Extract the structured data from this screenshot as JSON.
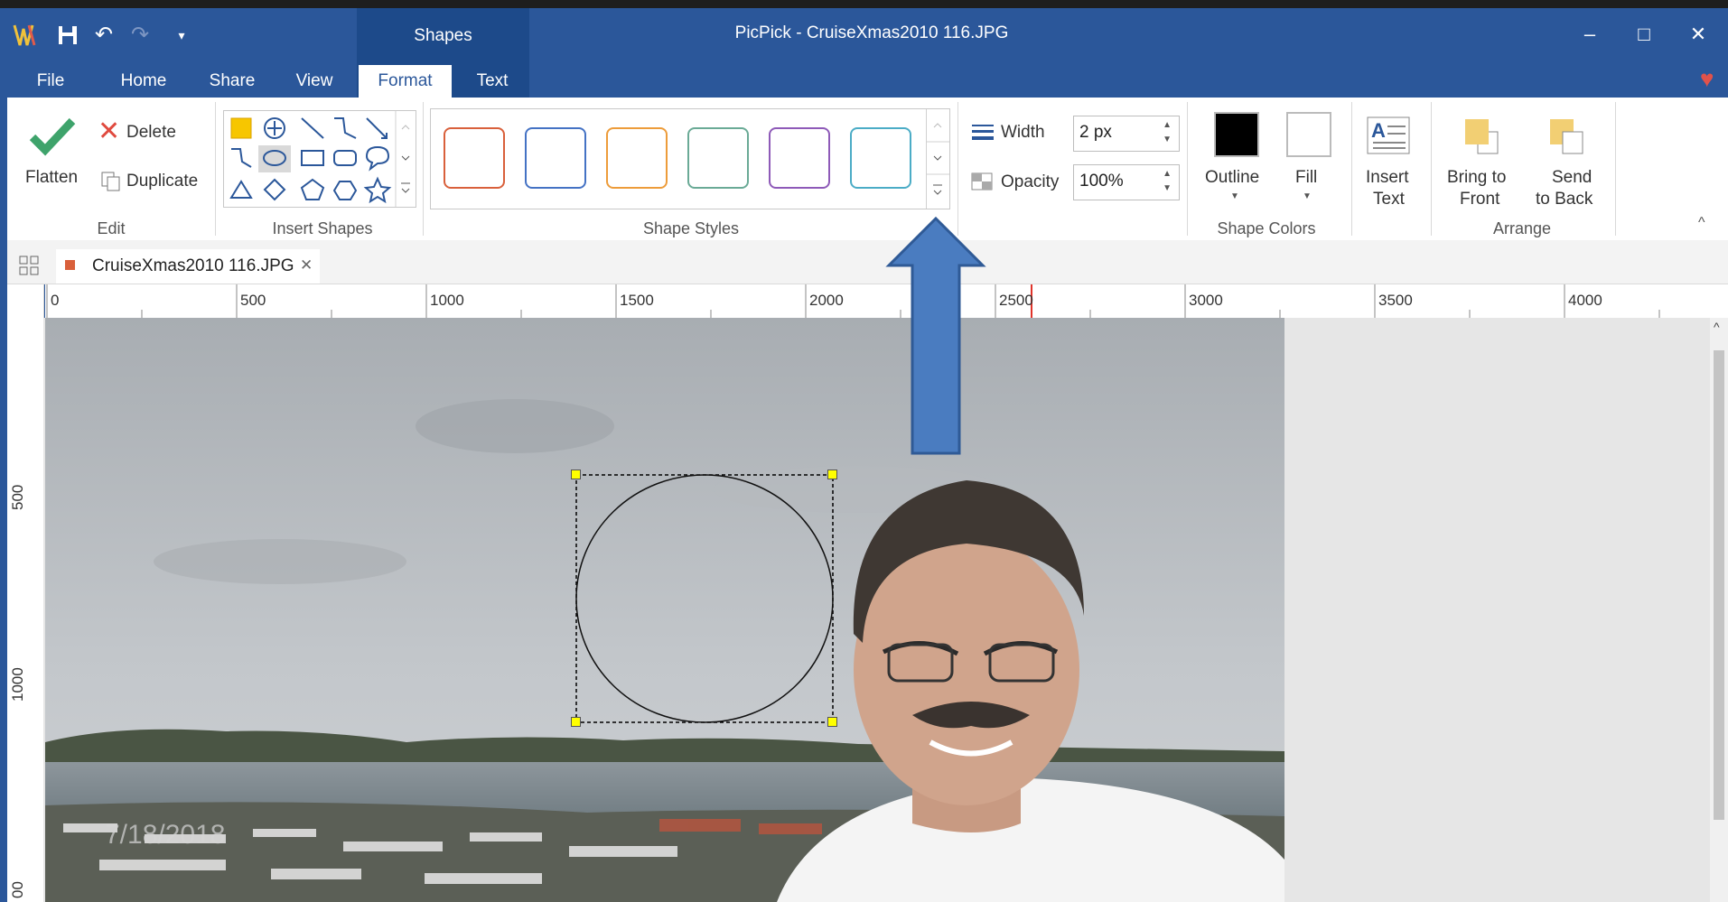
{
  "window": {
    "title": "PicPick - CruiseXmas2010 116.JPG",
    "context_tab_group": "Shapes",
    "minimize_glyph": "–",
    "maximize_glyph": "□",
    "close_glyph": "✕"
  },
  "menu_tabs": [
    "File",
    "Home",
    "Share",
    "View",
    "Format",
    "Text"
  ],
  "active_tab": "Format",
  "ribbon": {
    "edit": {
      "label": "Edit",
      "flatten": "Flatten",
      "delete": "Delete",
      "duplicate": "Duplicate"
    },
    "insert_shapes": {
      "label": "Insert Shapes"
    },
    "shape_styles": {
      "label": "Shape Styles",
      "swatch_colors": [
        "#d9603b",
        "#4472c4",
        "#ed9c3a",
        "#6aaa96",
        "#8e5ab8",
        "#4bacc6"
      ]
    },
    "line": {
      "width_label": "Width",
      "width_value": "2 px",
      "opacity_label": "Opacity",
      "opacity_value": "100%"
    },
    "shape_colors": {
      "label": "Shape Colors",
      "outline": "Outline",
      "outline_color": "#000000",
      "fill": "Fill",
      "fill_color": "#ffffff"
    },
    "insert_text": {
      "line1": "Insert",
      "line2": "Text"
    },
    "arrange": {
      "label": "Arrange",
      "bring_front_1": "Bring to",
      "bring_front_2": "Front",
      "send_back_1": "Send",
      "send_back_2": "to Back"
    }
  },
  "document_tab": {
    "name": "CruiseXmas2010 116.JPG",
    "close_glyph": "✕"
  },
  "ruler": {
    "h_labels": [
      "0",
      "500",
      "1000",
      "1500",
      "2000",
      "2500",
      "3000",
      "3500",
      "4000"
    ],
    "v_labels": [
      "500",
      "1000",
      "00"
    ]
  },
  "photo": {
    "date_stamp": "7/18/2018"
  },
  "accent_colors": {
    "title_blue": "#2b579a",
    "annotation_arrow": "#4a7cc0",
    "delete_red": "#e04a3f",
    "flatten_green": "#3ea36b"
  }
}
